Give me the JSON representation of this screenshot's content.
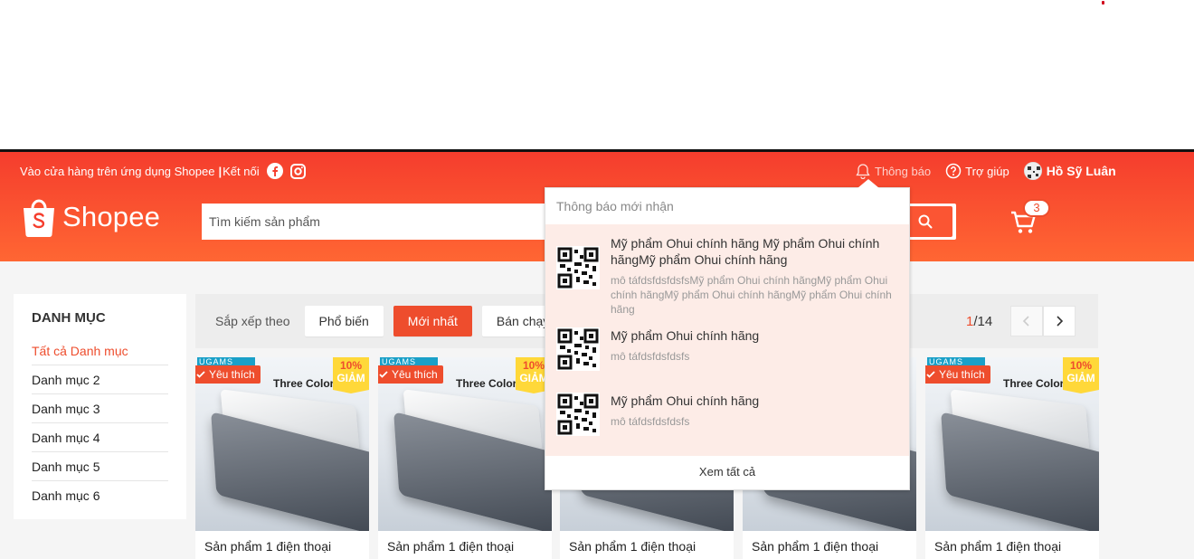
{
  "navbar": {
    "store_link": "Vào cửa hàng trên ứng dụng Shopee",
    "separator": "|",
    "connect": "Kết nối",
    "notifications": "Thông báo",
    "help": "Trợ giúp",
    "username": "Hồ Sỹ Luân"
  },
  "header": {
    "logo": "Shopee",
    "search_placeholder": "Tìm kiếm sản phẩm",
    "cart_count": "3"
  },
  "sidebar": {
    "title": "DANH MỤC",
    "items": [
      {
        "label": "Tất cả Danh mục",
        "active": true
      },
      {
        "label": "Danh mục 2"
      },
      {
        "label": "Danh mục 3"
      },
      {
        "label": "Danh mục 4"
      },
      {
        "label": "Danh mục 5"
      },
      {
        "label": "Danh mục 6"
      }
    ]
  },
  "sortbar": {
    "label": "Sắp xếp theo",
    "options": [
      "Phổ biến",
      "Mới nhất",
      "Bán chạy"
    ],
    "active": "Mới nhất",
    "page_current": "1",
    "page_total": "/14"
  },
  "product": {
    "brand": "UGAMS",
    "subtitle": "Three Colors",
    "favorite": "Yêu thích",
    "discount_pct": "10%",
    "discount_label": "GIẢM",
    "name": "Sản phẩm 1 điện thoại"
  },
  "notification_popup": {
    "header": "Thông báo mới nhận",
    "items": [
      {
        "title": "Mỹ phẩm Ohui chính hãng Mỹ phẩm Ohui chính hãngMỹ phẩm Ohui chính hãng",
        "desc": "mô táfdsfdsfdsfsMỹ phẩm Ohui chính hãngMỹ phẩm Ohui chính hãngMỹ phẩm Ohui chính hãngMỹ phẩm Ohui chính hãng"
      },
      {
        "title": "Mỹ phẩm Ohui chính hãng",
        "desc": "mô táfdsfdsfdsfs"
      },
      {
        "title": "Mỹ phẩm Ohui chính hãng",
        "desc": "mô táfdsfdsfdsfs"
      }
    ],
    "footer": "Xem tất cả"
  },
  "colors": {
    "brand": "#ee4d2d",
    "header_top": "#f53d2d",
    "header_bottom": "#ff6633",
    "notif_bg": "#fdece7",
    "discount_bg": "#ffd839"
  }
}
